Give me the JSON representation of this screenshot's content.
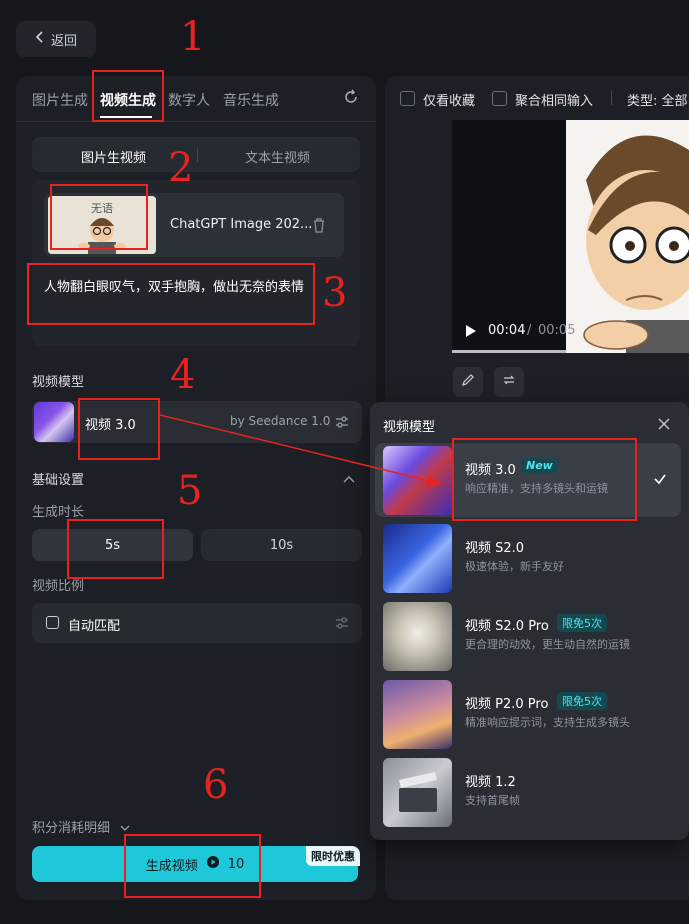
{
  "back": {
    "label": "返回"
  },
  "tabs": [
    {
      "label": "图片生成"
    },
    {
      "label": "视频生成"
    },
    {
      "label": "数字人"
    },
    {
      "label": "音乐生成"
    }
  ],
  "mode": {
    "image_to_video": "图片生视频",
    "text_to_video": "文本生视频"
  },
  "upload": {
    "file_name": "ChatGPT Image 202...",
    "thumb_caption": "无语"
  },
  "prompt": {
    "text": "人物翻白眼叹气，双手抱胸，做出无奈的表情"
  },
  "model_section": {
    "title": "视频模型",
    "name": "视频 3.0",
    "by": "by Seedance 1.0"
  },
  "basic": {
    "title": "基础设置",
    "duration_label": "生成时长",
    "durations": [
      "5s",
      "10s"
    ],
    "ratio_label": "视频比例",
    "ratio_value": "自动匹配"
  },
  "credits": {
    "label": "积分消耗明细"
  },
  "generate": {
    "label": "生成视频",
    "cost": "10",
    "promo": "限时优惠"
  },
  "right": {
    "fav_only": "仅看收藏",
    "merge_input": "聚合相同输入",
    "type_filter": "类型: 全部",
    "video_time": "00:04",
    "video_sep": "/",
    "video_total": "00:05"
  },
  "dropdown": {
    "title": "视频模型",
    "items": [
      {
        "name": "视频 3.0",
        "badge": "New",
        "desc": "响应精准，支持多镜头和运镜"
      },
      {
        "name": "视频 S2.0",
        "badge": "",
        "desc": "极速体验，新手友好"
      },
      {
        "name": "视频 S2.0 Pro",
        "badge": "限免5次",
        "desc": "更合理的动效，更生动自然的运镜"
      },
      {
        "name": "视频 P2.0 Pro",
        "badge": "限免5次",
        "desc": "精准响应提示词，支持生成多镜头"
      },
      {
        "name": "视频 1.2",
        "badge": "",
        "desc": "支持首尾帧"
      }
    ]
  },
  "annotations": {
    "n1": "1",
    "n2": "2",
    "n3": "3",
    "n4": "4",
    "n5": "5",
    "n6": "6"
  },
  "colors": {
    "accent": "#1fc8d8",
    "annotation": "#e8231f",
    "background": "#15171c",
    "panel": "#1c1f25"
  }
}
